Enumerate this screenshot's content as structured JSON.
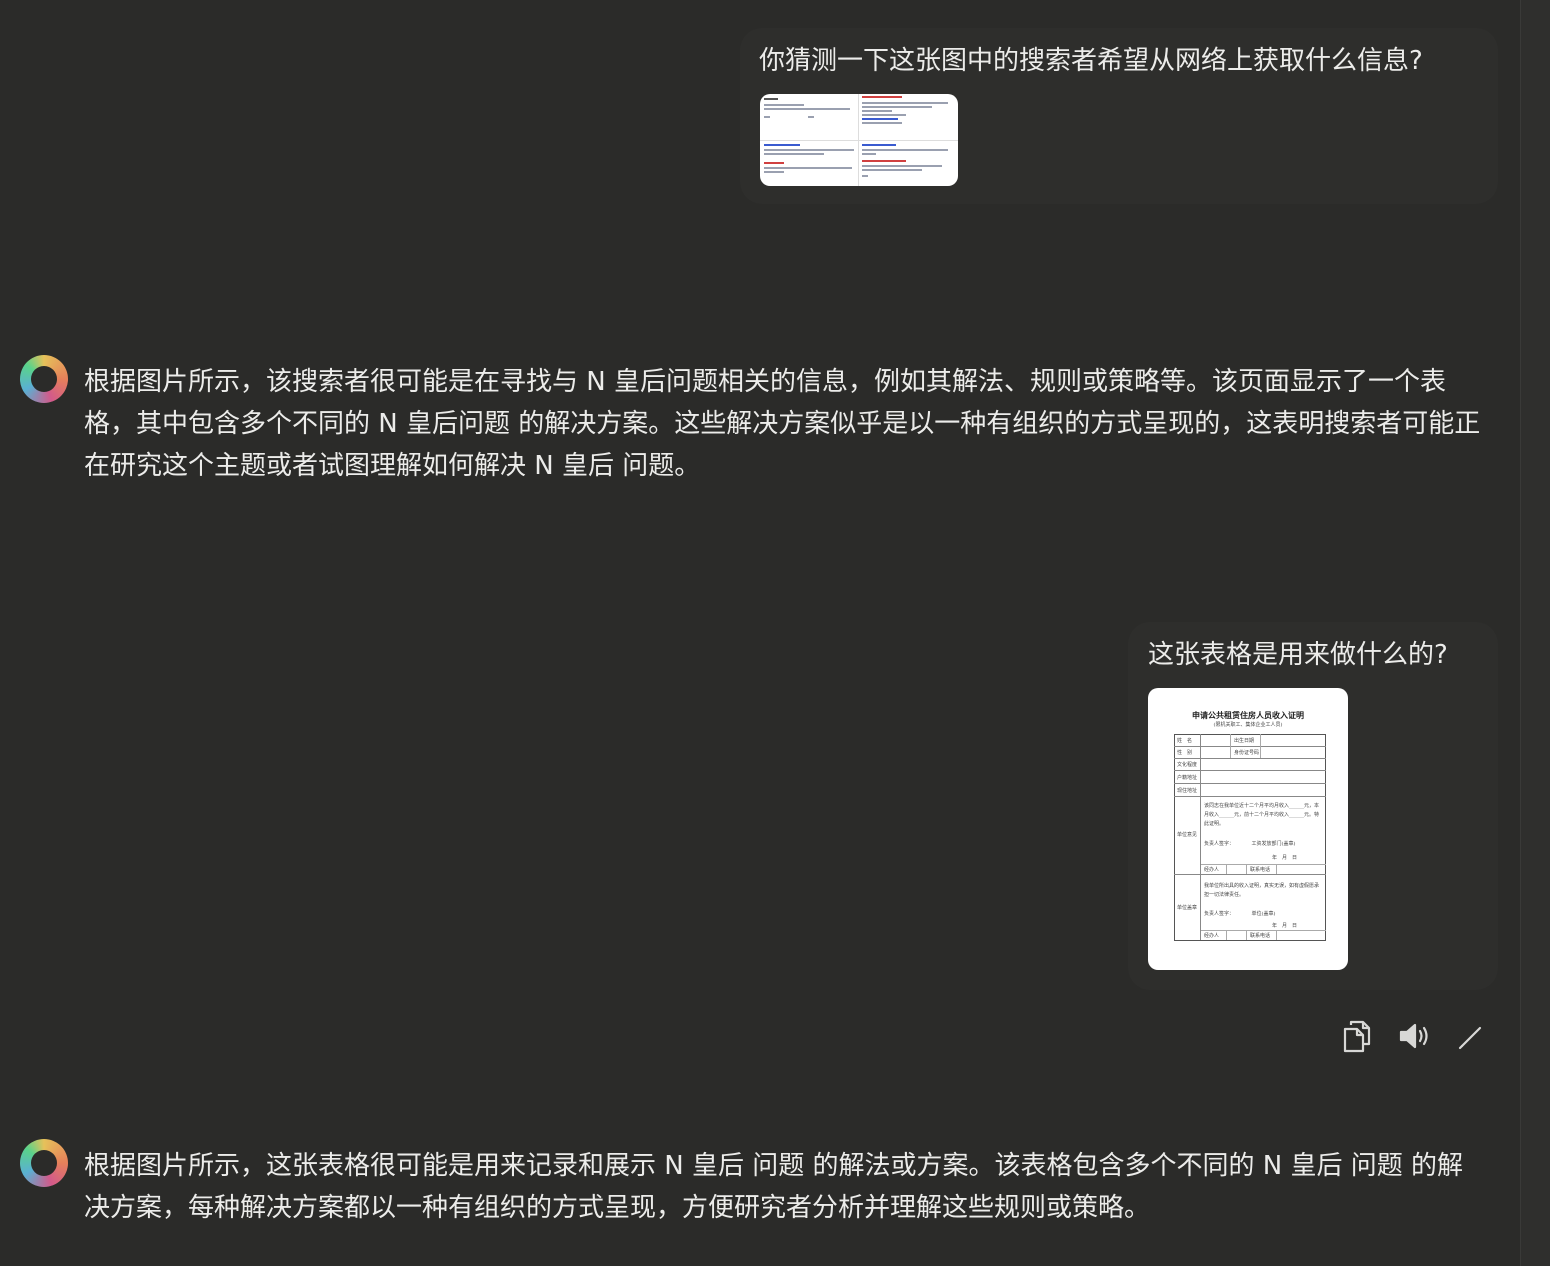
{
  "conversation": {
    "messages": [
      {
        "role": "user",
        "text": "你猜测一下这张图中的搜索者希望从网络上获取什么信息?",
        "attachment": "search-results-screenshot"
      },
      {
        "role": "assistant",
        "text": "根据图片所示，该搜索者很可能是在寻找与 N 皇后问题相关的信息，例如其解法、规则或策略等。该页面显示了一个表格，其中包含多个不同的 N 皇后问题 的解决方案。这些解决方案似乎是以一种有组织的方式呈现的，这表明搜索者可能正在研究这个主题或者试图理解如何解决 N 皇后 问题。"
      },
      {
        "role": "user",
        "text": "这张表格是用来做什么的?",
        "attachment": "income-certificate-form"
      },
      {
        "role": "assistant",
        "text": "根据图片所示，这张表格很可能是用来记录和展示 N 皇后 问题 的解法或方案。该表格包含多个不同的 N 皇后 问题 的解决方案，每种解决方案都以一种有组织的方式呈现，方便研究者分析并理解这些规则或策略。"
      }
    ]
  },
  "form_thumbnail": {
    "title": "申请公共租赁住房人员收入证明",
    "subtitle": "(限机关职工、集体企业工人员)",
    "rows": [
      "姓　名",
      "性　别",
      "文化程度",
      "户籍地址",
      "现住地址"
    ],
    "col2": [
      "出生日期",
      "身份证号码"
    ],
    "section1": "单位意见",
    "section1_text": "该同志在我单位近十二个月平均月收入______元，本月收入______元，前十二个月平均收入______元。特此证明。",
    "section1_sign": "负责人签字：　　　　工资发放部门(盖章)",
    "section1_date": "年　月　日",
    "handler": "经办人",
    "phone": "联系电话",
    "section2": "单位盖章",
    "section2_text": "我单位所出具的收入证明，真实无误，如有虚假愿承担一切法律责任。",
    "section2_sign": "负责人签字：　　　　单位(盖章)",
    "section2_date": "年　月　日"
  },
  "actions": {
    "copy": "copy-icon",
    "speak": "speaker-icon",
    "edit": "pencil-icon"
  },
  "colors": {
    "background": "#2b2b29",
    "text": "#ececea"
  }
}
